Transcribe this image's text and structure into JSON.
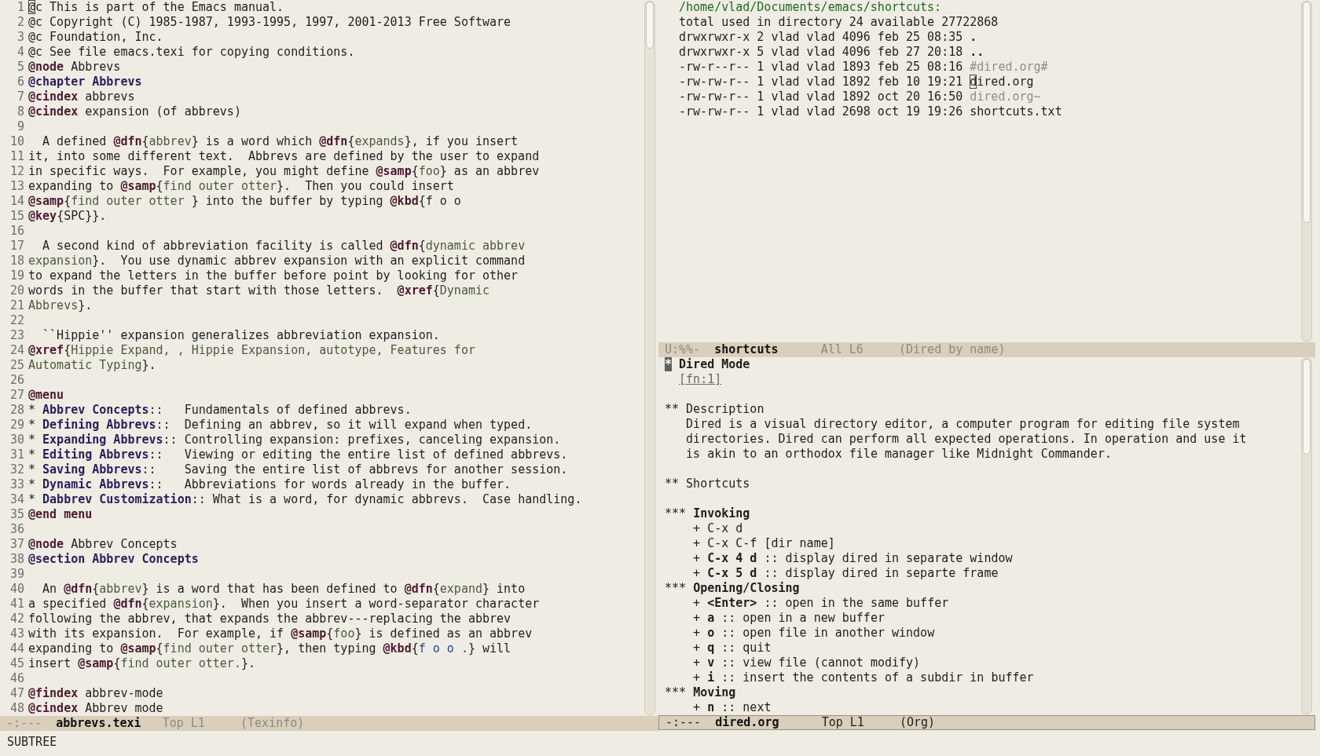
{
  "left_window": {
    "lines": [
      {
        "number": "1",
        "segments": [
          {
            "kind": "cursor",
            "text": "@"
          },
          {
            "kind": "plain",
            "text": "c This is part of the Emacs manual."
          }
        ]
      },
      {
        "number": "2",
        "segments": [
          {
            "kind": "plain",
            "text": "@c Copyright (C) 1985-1987, 1993-1995, 1997, 2001-2013 Free Software"
          }
        ]
      },
      {
        "number": "3",
        "segments": [
          {
            "kind": "plain",
            "text": "@c Foundation, Inc."
          }
        ]
      },
      {
        "number": "4",
        "segments": [
          {
            "kind": "plain",
            "text": "@c See file emacs.texi for copying conditions."
          }
        ]
      },
      {
        "number": "5",
        "segments": [
          {
            "kind": "keyword",
            "text": "@node"
          },
          {
            "kind": "plain",
            "text": " Abbrevs"
          }
        ]
      },
      {
        "number": "6",
        "segments": [
          {
            "kind": "heading",
            "text": "@chapter Abbrevs"
          }
        ]
      },
      {
        "number": "7",
        "segments": [
          {
            "kind": "keyword",
            "text": "@cindex"
          },
          {
            "kind": "plain",
            "text": " abbrevs"
          }
        ]
      },
      {
        "number": "8",
        "segments": [
          {
            "kind": "keyword",
            "text": "@cindex"
          },
          {
            "kind": "plain",
            "text": " expansion (of abbrevs)"
          }
        ]
      },
      {
        "number": "9"
      },
      {
        "number": "10",
        "segments": [
          {
            "kind": "plain",
            "text": "  A defined "
          },
          {
            "kind": "keyword",
            "text": "@dfn"
          },
          {
            "kind": "plain",
            "text": "{"
          },
          {
            "kind": "arg",
            "text": "abbrev"
          },
          {
            "kind": "plain",
            "text": "} is a word which "
          },
          {
            "kind": "keyword",
            "text": "@dfn"
          },
          {
            "kind": "plain",
            "text": "{"
          },
          {
            "kind": "arg",
            "text": "expands"
          },
          {
            "kind": "plain",
            "text": "}, if you insert"
          }
        ]
      },
      {
        "number": "11",
        "segments": [
          {
            "kind": "plain",
            "text": "it, into some different text.  Abbrevs are defined by the user to expand"
          }
        ]
      },
      {
        "number": "12",
        "segments": [
          {
            "kind": "plain",
            "text": "in specific ways.  For example, you might define "
          },
          {
            "kind": "keyword",
            "text": "@samp"
          },
          {
            "kind": "plain",
            "text": "{"
          },
          {
            "kind": "arg",
            "text": "foo"
          },
          {
            "kind": "plain",
            "text": "} as an abbrev"
          }
        ]
      },
      {
        "number": "13",
        "segments": [
          {
            "kind": "plain",
            "text": "expanding to "
          },
          {
            "kind": "keyword",
            "text": "@samp"
          },
          {
            "kind": "plain",
            "text": "{"
          },
          {
            "kind": "arg",
            "text": "find outer otter"
          },
          {
            "kind": "plain",
            "text": "}.  Then you could insert"
          }
        ]
      },
      {
        "number": "14",
        "segments": [
          {
            "kind": "keyword",
            "text": "@samp"
          },
          {
            "kind": "plain",
            "text": "{"
          },
          {
            "kind": "arg",
            "text": "find outer otter "
          },
          {
            "kind": "plain",
            "text": "} into the buffer by typing "
          },
          {
            "kind": "keyword",
            "text": "@kbd"
          },
          {
            "kind": "plain",
            "text": "{f o o"
          }
        ]
      },
      {
        "number": "15",
        "segments": [
          {
            "kind": "keyword",
            "text": "@key"
          },
          {
            "kind": "plain",
            "text": "{SPC}}."
          }
        ]
      },
      {
        "number": "16"
      },
      {
        "number": "17",
        "segments": [
          {
            "kind": "plain",
            "text": "  A second kind of abbreviation facility is called "
          },
          {
            "kind": "keyword",
            "text": "@dfn"
          },
          {
            "kind": "plain",
            "text": "{"
          },
          {
            "kind": "arg",
            "text": "dynamic abbrev"
          }
        ]
      },
      {
        "number": "18",
        "segments": [
          {
            "kind": "arg",
            "text": "expansion"
          },
          {
            "kind": "plain",
            "text": "}.  You use dynamic abbrev expansion with an explicit command"
          }
        ]
      },
      {
        "number": "19",
        "segments": [
          {
            "kind": "plain",
            "text": "to expand the letters in the buffer before point by looking for other"
          }
        ]
      },
      {
        "number": "20",
        "segments": [
          {
            "kind": "plain",
            "text": "words in the buffer that start with those letters.  "
          },
          {
            "kind": "keyword",
            "text": "@xref"
          },
          {
            "kind": "plain",
            "text": "{"
          },
          {
            "kind": "arg",
            "text": "Dynamic"
          }
        ]
      },
      {
        "number": "21",
        "segments": [
          {
            "kind": "arg",
            "text": "Abbrevs"
          },
          {
            "kind": "plain",
            "text": "}."
          }
        ]
      },
      {
        "number": "22"
      },
      {
        "number": "23",
        "segments": [
          {
            "kind": "plain",
            "text": "  ``Hippie'' expansion generalizes abbreviation expansion."
          }
        ]
      },
      {
        "number": "24",
        "segments": [
          {
            "kind": "keyword",
            "text": "@xref"
          },
          {
            "kind": "plain",
            "text": "{"
          },
          {
            "kind": "arg",
            "text": "Hippie Expand, , Hippie Expansion, autotype, Features for"
          }
        ]
      },
      {
        "number": "25",
        "segments": [
          {
            "kind": "arg",
            "text": "Automatic Typing"
          },
          {
            "kind": "plain",
            "text": "}."
          }
        ]
      },
      {
        "number": "26"
      },
      {
        "number": "27",
        "segments": [
          {
            "kind": "keyword",
            "text": "@menu"
          }
        ]
      },
      {
        "number": "28",
        "segments": [
          {
            "kind": "plain",
            "text": "* "
          },
          {
            "kind": "heading",
            "text": "Abbrev Concepts"
          },
          {
            "kind": "plain",
            "text": "::   Fundamentals of defined abbrevs."
          }
        ]
      },
      {
        "number": "29",
        "segments": [
          {
            "kind": "plain",
            "text": "* "
          },
          {
            "kind": "heading",
            "text": "Defining Abbrevs"
          },
          {
            "kind": "plain",
            "text": "::  Defining an abbrev, so it will expand when typed."
          }
        ]
      },
      {
        "number": "30",
        "segments": [
          {
            "kind": "plain",
            "text": "* "
          },
          {
            "kind": "heading",
            "text": "Expanding Abbrevs"
          },
          {
            "kind": "plain",
            "text": ":: Controlling expansion: prefixes, canceling expansion."
          }
        ]
      },
      {
        "number": "31",
        "segments": [
          {
            "kind": "plain",
            "text": "* "
          },
          {
            "kind": "heading",
            "text": "Editing Abbrevs"
          },
          {
            "kind": "plain",
            "text": "::   Viewing or editing the entire list of defined abbrevs."
          }
        ]
      },
      {
        "number": "32",
        "segments": [
          {
            "kind": "plain",
            "text": "* "
          },
          {
            "kind": "heading",
            "text": "Saving Abbrevs"
          },
          {
            "kind": "plain",
            "text": "::    Saving the entire list of abbrevs for another session."
          }
        ]
      },
      {
        "number": "33",
        "segments": [
          {
            "kind": "plain",
            "text": "* "
          },
          {
            "kind": "heading",
            "text": "Dynamic Abbrevs"
          },
          {
            "kind": "plain",
            "text": "::   Abbreviations for words already in the buffer."
          }
        ]
      },
      {
        "number": "34",
        "segments": [
          {
            "kind": "plain",
            "text": "* "
          },
          {
            "kind": "heading",
            "text": "Dabbrev Customization"
          },
          {
            "kind": "plain",
            "text": ":: What is a word, for dynamic abbrevs.  Case handling."
          }
        ]
      },
      {
        "number": "35",
        "segments": [
          {
            "kind": "keyword",
            "text": "@end menu"
          }
        ]
      },
      {
        "number": "36"
      },
      {
        "number": "37",
        "segments": [
          {
            "kind": "keyword",
            "text": "@node"
          },
          {
            "kind": "plain",
            "text": " Abbrev Concepts"
          }
        ]
      },
      {
        "number": "38",
        "segments": [
          {
            "kind": "heading",
            "text": "@section Abbrev Concepts"
          }
        ]
      },
      {
        "number": "39"
      },
      {
        "number": "40",
        "segments": [
          {
            "kind": "plain",
            "text": "  An "
          },
          {
            "kind": "keyword",
            "text": "@dfn"
          },
          {
            "kind": "plain",
            "text": "{"
          },
          {
            "kind": "arg",
            "text": "abbrev"
          },
          {
            "kind": "plain",
            "text": "} is a word that has been defined to "
          },
          {
            "kind": "keyword",
            "text": "@dfn"
          },
          {
            "kind": "plain",
            "text": "{"
          },
          {
            "kind": "arg",
            "text": "expand"
          },
          {
            "kind": "plain",
            "text": "} into"
          }
        ]
      },
      {
        "number": "41",
        "segments": [
          {
            "kind": "plain",
            "text": "a specified "
          },
          {
            "kind": "keyword",
            "text": "@dfn"
          },
          {
            "kind": "plain",
            "text": "{"
          },
          {
            "kind": "arg",
            "text": "expansion"
          },
          {
            "kind": "plain",
            "text": "}.  When you insert a word-separator character"
          }
        ]
      },
      {
        "number": "42",
        "segments": [
          {
            "kind": "plain",
            "text": "following the abbrev, that expands the abbrev---replacing the abbrev"
          }
        ]
      },
      {
        "number": "43",
        "segments": [
          {
            "kind": "plain",
            "text": "with its expansion.  For example, if "
          },
          {
            "kind": "keyword",
            "text": "@samp"
          },
          {
            "kind": "plain",
            "text": "{"
          },
          {
            "kind": "arg",
            "text": "foo"
          },
          {
            "kind": "plain",
            "text": "} is defined as an abbrev"
          }
        ]
      },
      {
        "number": "44",
        "segments": [
          {
            "kind": "plain",
            "text": "expanding to "
          },
          {
            "kind": "keyword",
            "text": "@samp"
          },
          {
            "kind": "plain",
            "text": "{"
          },
          {
            "kind": "arg",
            "text": "find outer otter"
          },
          {
            "kind": "plain",
            "text": "}, then typing "
          },
          {
            "kind": "keyword",
            "text": "@kbd"
          },
          {
            "kind": "plain",
            "text": "{"
          },
          {
            "kind": "key",
            "text": "f o o ."
          },
          {
            "kind": "plain",
            "text": "} will"
          }
        ]
      },
      {
        "number": "45",
        "segments": [
          {
            "kind": "plain",
            "text": "insert "
          },
          {
            "kind": "keyword",
            "text": "@samp"
          },
          {
            "kind": "plain",
            "text": "{"
          },
          {
            "kind": "arg",
            "text": "find outer otter."
          },
          {
            "kind": "plain",
            "text": "}."
          }
        ]
      },
      {
        "number": "46"
      },
      {
        "number": "47",
        "segments": [
          {
            "kind": "keyword",
            "text": "@findex"
          },
          {
            "kind": "plain",
            "text": " abbrev-mode"
          }
        ]
      },
      {
        "number": "48",
        "segments": [
          {
            "kind": "keyword",
            "text": "@cindex"
          },
          {
            "kind": "plain",
            "text": " Abbrev mode"
          }
        ]
      }
    ],
    "mode_line": {
      "active": false,
      "fields": [
        "-:---",
        "abbrevs.texi",
        "Top L1",
        "(Texinfo)"
      ]
    }
  },
  "dired_window": {
    "lines": [
      {
        "segments": [
          {
            "kind": "directory",
            "text": "/home/vlad/Documents/emacs/shortcuts:"
          }
        ]
      },
      {
        "segments": [
          {
            "kind": "plain",
            "text": "total used in directory 24 available 27722868"
          }
        ]
      },
      {
        "segments": [
          {
            "kind": "plain",
            "text": "drwxrwxr-x 2 vlad vlad 4096 feb 25 08:35 "
          },
          {
            "kind": "heading",
            "text": "."
          }
        ]
      },
      {
        "segments": [
          {
            "kind": "plain",
            "text": "drwxrwxr-x 5 vlad vlad 4096 feb 27 20:18 "
          },
          {
            "kind": "heading",
            "text": ".."
          }
        ]
      },
      {
        "segments": [
          {
            "kind": "plain",
            "text": "-rw-r--r-- 1 vlad vlad 1893 feb 25 08:16 "
          },
          {
            "kind": "dim",
            "text": "#dired.org#"
          }
        ]
      },
      {
        "segments": [
          {
            "kind": "plain",
            "text": "-rw-rw-r-- 1 vlad vlad 1892 feb 10 19:21 "
          },
          {
            "kind": "cursor",
            "text": "d"
          },
          {
            "kind": "plain",
            "text": "ired.org"
          }
        ]
      },
      {
        "segments": [
          {
            "kind": "plain",
            "text": "-rw-rw-r-- 1 vlad vlad 1892 oct 20 16:50 "
          },
          {
            "kind": "dim",
            "text": "dired.org~"
          }
        ]
      },
      {
        "segments": [
          {
            "kind": "plain",
            "text": "-rw-rw-r-- 1 vlad vlad 2698 oct 19 19:26 shortcuts.txt"
          }
        ]
      }
    ],
    "mode_line": {
      "active": false,
      "fields": [
        "U:%%-",
        "shortcuts",
        "All L6",
        "(Dired by name)"
      ]
    }
  },
  "org_window": {
    "blocks": [
      {
        "lines": [
          {
            "segments": [
              {
                "kind": "star",
                "text": "*"
              },
              {
                "kind": "bold",
                "text": " Dired Mode"
              }
            ]
          },
          {
            "segments": [
              {
                "kind": "link",
                "text": "[fn:1]"
              }
            ]
          }
        ]
      },
      {
        "lines": [
          {
            "segments": [
              {
                "kind": "plain",
                "text": "** Description"
              }
            ]
          },
          {
            "segments": [
              {
                "kind": "plain",
                "text": "   Dired is a visual directory editor, a computer program for editing file system"
              }
            ]
          },
          {
            "segments": [
              {
                "kind": "plain",
                "text": "   directories. Dired can perform all expected operations. In operation and use it"
              }
            ]
          },
          {
            "segments": [
              {
                "kind": "plain",
                "text": "   is akin to an orthodox file manager like Midnight Commander."
              }
            ]
          }
        ]
      },
      {
        "lines": [
          {
            "segments": [
              {
                "kind": "plain",
                "text": "** Shortcuts"
              }
            ]
          }
        ]
      },
      {
        "lines": [
          {
            "segments": [
              {
                "kind": "plain",
                "text": "*** "
              },
              {
                "kind": "bold",
                "text": "Invoking"
              }
            ]
          },
          {
            "segments": [
              {
                "kind": "plain",
                "text": "    + C-x d"
              }
            ]
          },
          {
            "segments": [
              {
                "kind": "plain",
                "text": "    + C-x C-f [dir name]"
              }
            ]
          },
          {
            "segments": [
              {
                "kind": "plain",
                "text": "    + "
              },
              {
                "kind": "bold",
                "text": "C-x 4 d"
              },
              {
                "kind": "plain",
                "text": " :: display dired in separate window"
              }
            ]
          },
          {
            "segments": [
              {
                "kind": "plain",
                "text": "    + "
              },
              {
                "kind": "bold",
                "text": "C-x 5 d"
              },
              {
                "kind": "plain",
                "text": " :: display dired in separte frame"
              }
            ]
          },
          {
            "segments": [
              {
                "kind": "plain",
                "text": "*** "
              },
              {
                "kind": "bold",
                "text": "Opening/Closing"
              }
            ]
          },
          {
            "segments": [
              {
                "kind": "plain",
                "text": "    + "
              },
              {
                "kind": "bold",
                "text": "<Enter>"
              },
              {
                "kind": "plain",
                "text": " :: open in the same buffer"
              }
            ]
          },
          {
            "segments": [
              {
                "kind": "plain",
                "text": "    + "
              },
              {
                "kind": "bold",
                "text": "a"
              },
              {
                "kind": "plain",
                "text": " :: open in a new buffer"
              }
            ]
          },
          {
            "segments": [
              {
                "kind": "plain",
                "text": "    + "
              },
              {
                "kind": "bold",
                "text": "o"
              },
              {
                "kind": "plain",
                "text": " :: open file in another window"
              }
            ]
          },
          {
            "segments": [
              {
                "kind": "plain",
                "text": "    + "
              },
              {
                "kind": "bold",
                "text": "q"
              },
              {
                "kind": "plain",
                "text": " :: quit"
              }
            ]
          },
          {
            "segments": [
              {
                "kind": "plain",
                "text": "    + "
              },
              {
                "kind": "bold",
                "text": "v"
              },
              {
                "kind": "plain",
                "text": " :: view file (cannot modify)"
              }
            ]
          },
          {
            "segments": [
              {
                "kind": "plain",
                "text": "    + "
              },
              {
                "kind": "bold",
                "text": "i"
              },
              {
                "kind": "plain",
                "text": " :: insert the contents of a subdir in buffer"
              }
            ]
          },
          {
            "segments": [
              {
                "kind": "plain",
                "text": "*** "
              },
              {
                "kind": "bold",
                "text": "Moving"
              }
            ]
          },
          {
            "segments": [
              {
                "kind": "plain",
                "text": "    + "
              },
              {
                "kind": "bold",
                "text": "n"
              },
              {
                "kind": "plain",
                "text": " :: next"
              }
            ]
          }
        ]
      }
    ],
    "mode_line": {
      "active": true,
      "fields": [
        "-:---",
        "dired.org",
        "Top L1",
        "(Org)"
      ]
    }
  },
  "minibuffer": {
    "text": "SUBTREE"
  }
}
